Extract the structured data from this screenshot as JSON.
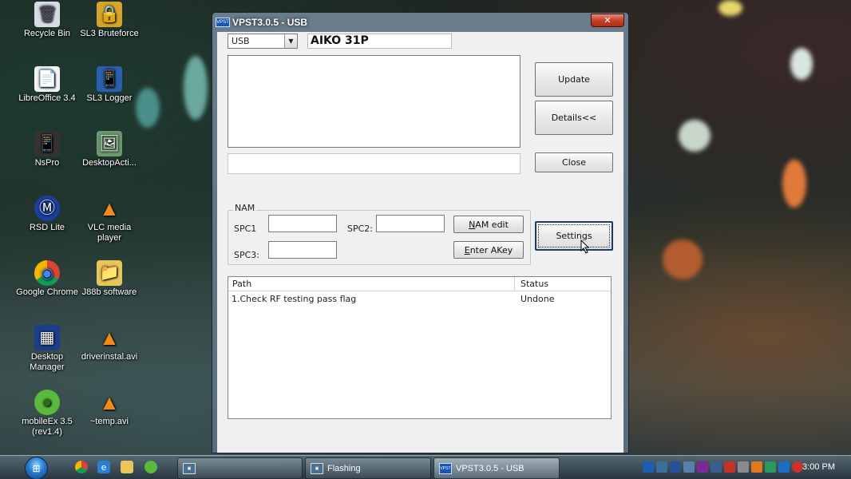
{
  "desktop": {
    "icons": [
      {
        "label": "Recycle Bin",
        "glyph": "🗑",
        "icon": "recycle-bin-icon"
      },
      {
        "label": "SL3 Bruteforce",
        "glyph": "🔒",
        "icon": "lock-icon"
      },
      {
        "label": "LibreOffice 3.4",
        "glyph": "📄",
        "icon": "document-icon"
      },
      {
        "label": "SL3 Logger",
        "glyph": "📱",
        "icon": "phone-icon"
      },
      {
        "label": "NsPro",
        "glyph": "📱",
        "icon": "phone-icon"
      },
      {
        "label": "DesktopActi...",
        "glyph": "🖼",
        "icon": "image-icon"
      },
      {
        "label": "RSD Lite",
        "glyph": "Ⓜ",
        "icon": "motorola-icon"
      },
      {
        "label": "VLC media player",
        "glyph": "▲",
        "icon": "vlc-cone-icon"
      },
      {
        "label": "Google Chrome",
        "glyph": "◉",
        "icon": "chrome-icon"
      },
      {
        "label": "J88b software",
        "glyph": "📁",
        "icon": "folder-icon"
      },
      {
        "label": "Desktop Manager",
        "glyph": "▦",
        "icon": "blackberry-icon"
      },
      {
        "label": "driverinstal.avi",
        "glyph": "▲",
        "icon": "vlc-cone-icon"
      },
      {
        "label": "mobileEx 3.5 (rev1.4)",
        "glyph": "●",
        "icon": "mobileex-icon"
      },
      {
        "label": "~temp.avi",
        "glyph": "▲",
        "icon": "vlc-cone-icon"
      }
    ]
  },
  "window": {
    "title": "VPST3.0.5 - USB",
    "icon_text": "VPST",
    "close_glyph": "✕",
    "port_select": "USB",
    "dropdown_glyph": "▼",
    "model_field": "AIKO 31P",
    "update_button": "Update",
    "details_button": "Details<<",
    "close_button": "Close",
    "settings_button": "Settings",
    "nam": {
      "group_label": "NAM",
      "spc1_label": "SPC1",
      "spc2_label": "SPC2:",
      "spc3_label": "SPC3:",
      "spc1_value": "",
      "spc2_value": "",
      "spc3_value": "",
      "nam_edit_prefix": "N",
      "nam_edit_rest": "AM edit",
      "enter_akey_prefix": "E",
      "enter_akey_rest": "nter AKey"
    },
    "table": {
      "headers": [
        "Path",
        "Status"
      ],
      "rows": [
        {
          "path": "1.Check RF testing pass flag",
          "status": "Undone"
        }
      ]
    }
  },
  "taskbar": {
    "start_glyph": "⊞",
    "tasks": [
      {
        "label": "",
        "icon_text": "▣"
      },
      {
        "label": "Flashing",
        "icon_text": "▣"
      },
      {
        "label": "VPST3.0.5 - USB",
        "icon_text": "VPST"
      }
    ],
    "clock": "3:00 PM"
  }
}
